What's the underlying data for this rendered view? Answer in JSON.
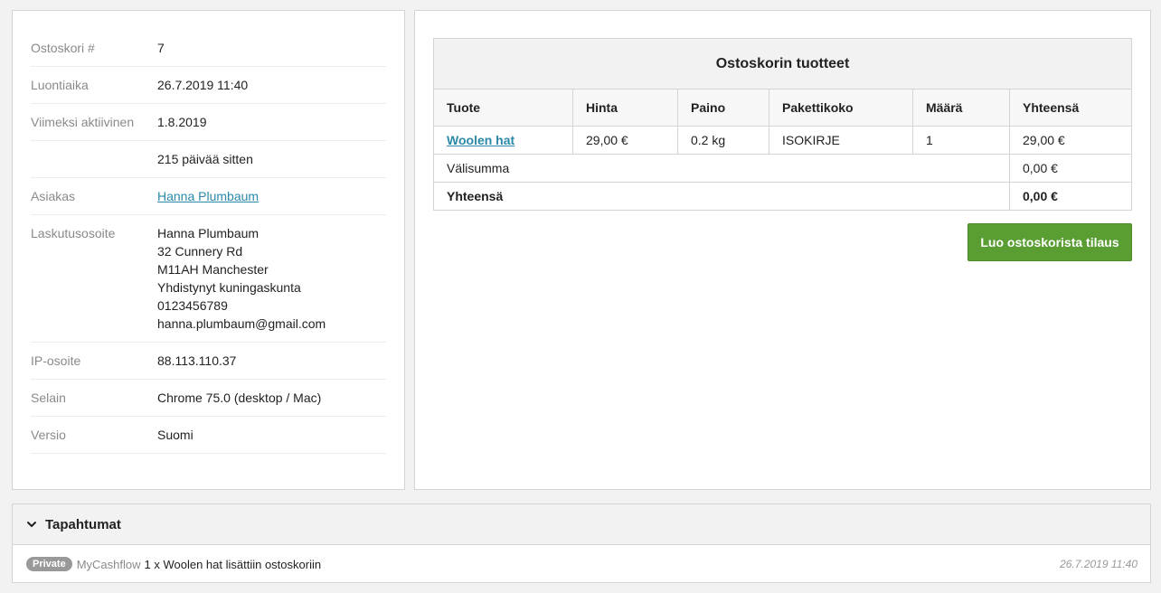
{
  "cart_info": {
    "rows": [
      {
        "label": "Ostoskori #",
        "value": "7"
      },
      {
        "label": "Luontiaika",
        "value": "26.7.2019 11:40"
      },
      {
        "label": "Viimeksi aktiivinen",
        "value": "1.8.2019"
      },
      {
        "label": "",
        "value": "215 päivää sitten"
      },
      {
        "label": "Asiakas",
        "value": "Hanna Plumbaum"
      },
      {
        "label": "Laskutusosoite",
        "value": ""
      },
      {
        "label": "IP-osoite",
        "value": "88.113.110.37"
      },
      {
        "label": "Selain",
        "value": "Chrome 75.0 (desktop / Mac)"
      },
      {
        "label": "Versio",
        "value": "Suomi"
      }
    ],
    "billing_address": [
      "Hanna Plumbaum",
      "32 Cunnery Rd",
      "M11AH Manchester",
      "Yhdistynyt kuningaskunta",
      "0123456789",
      "hanna.plumbaum@gmail.com"
    ]
  },
  "cart_products": {
    "title": "Ostoskorin tuotteet",
    "columns": [
      "Tuote",
      "Hinta",
      "Paino",
      "Pakettikoko",
      "Määrä",
      "Yhteensä"
    ],
    "items": [
      {
        "product": "Woolen hat",
        "price": "29,00 €",
        "weight": "0.2 kg",
        "package": "ISOKIRJE",
        "quantity": "1",
        "total": "29,00 €"
      }
    ],
    "subtotal_label": "Välisumma",
    "subtotal_value": "0,00 €",
    "total_label": "Yhteensä",
    "total_value": "0,00 €"
  },
  "actions": {
    "create_order_label": "Luo ostoskorista tilaus"
  },
  "events": {
    "title": "Tapahtumat",
    "items": [
      {
        "badge": "Private",
        "source": "MyCashflow",
        "text": "1 x Woolen hat lisättiin ostoskoriin",
        "date": "26.7.2019",
        "time": "11:40"
      }
    ]
  },
  "colors": {
    "accent_button": "#5a9e33",
    "link": "#2a88a8"
  }
}
